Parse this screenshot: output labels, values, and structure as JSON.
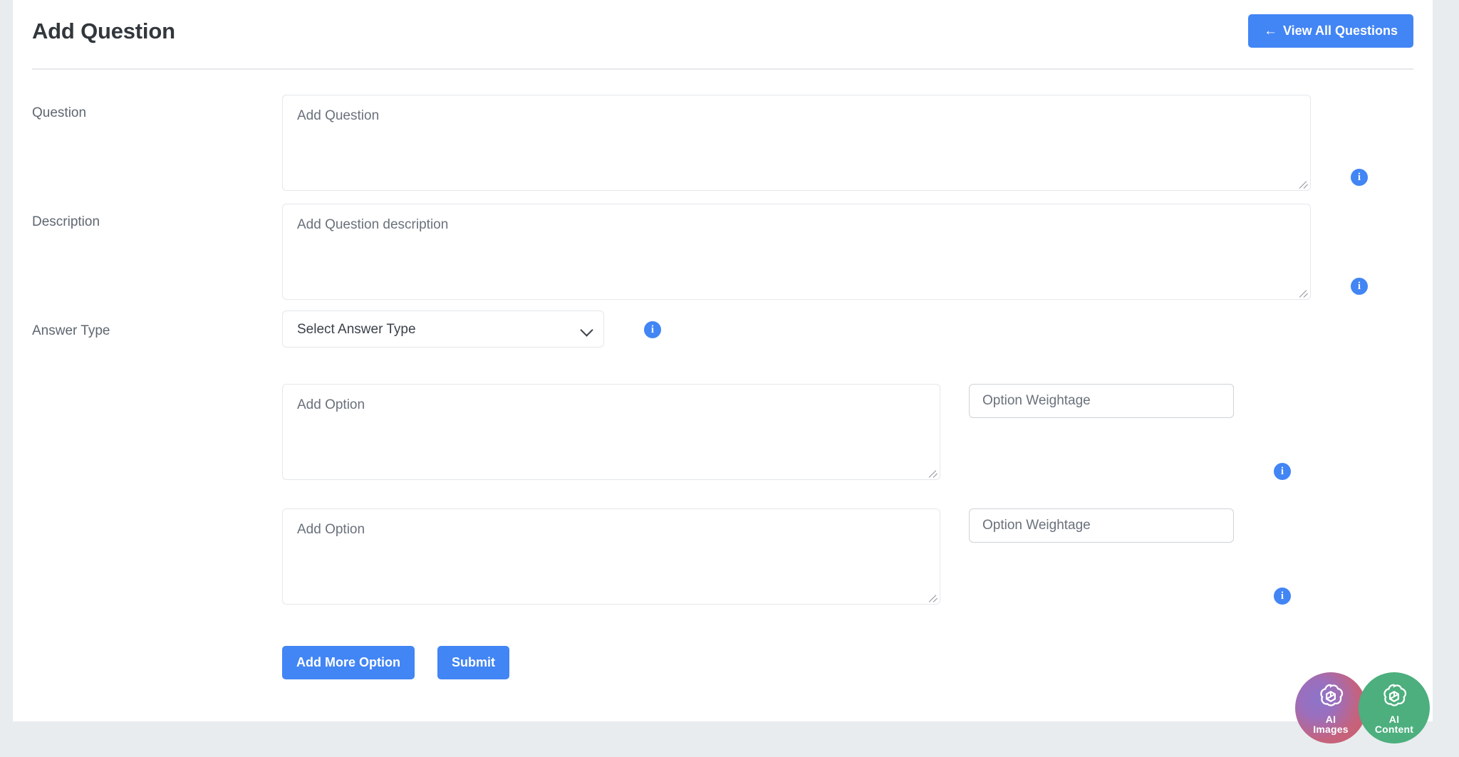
{
  "header": {
    "title": "Add Question",
    "view_all_button": {
      "label": "View All Questions",
      "arrow": "←"
    }
  },
  "colors": {
    "accent_blue": "#4285f4",
    "page_background": "#e8ecef",
    "card_background": "#ffffff",
    "label_text": "#5f6670",
    "title_text": "#32373c",
    "placeholder_text": "#6a717b",
    "border": "#e4e7ea",
    "divider": "#e6e8ec",
    "ai_content_green": "#4caf7d"
  },
  "form": {
    "fields": [
      {
        "label": "Question",
        "placeholder": "Add Question",
        "value": "",
        "info_icon": "info-icon"
      },
      {
        "label": "Description",
        "placeholder": "Add Question description",
        "value": "",
        "info_icon": "info-icon"
      }
    ],
    "answer_type": {
      "label": "Answer Type",
      "selected": "Select Answer Type",
      "options": [
        "Select Answer Type"
      ],
      "chevron_icon": "chevron-down-icon",
      "info_icon": "info-icon"
    },
    "options": [
      {
        "option_placeholder": "Add Option",
        "option_value": "",
        "weightage_placeholder": "Option Weightage",
        "weightage_value": "",
        "info_icon": "info-icon"
      },
      {
        "option_placeholder": "Add Option",
        "option_value": "",
        "weightage_placeholder": "Option Weightage",
        "weightage_value": "",
        "info_icon": "info-icon"
      }
    ],
    "actions": {
      "add_more_option": "Add More Option",
      "submit": "Submit"
    }
  },
  "floating_widgets": [
    {
      "name": "ai-images",
      "line1": "AI",
      "line2": "Images",
      "logo_icon": "openai-knot-icon"
    },
    {
      "name": "ai-content",
      "line1": "AI",
      "line2": "Content",
      "logo_icon": "openai-knot-icon"
    }
  ]
}
